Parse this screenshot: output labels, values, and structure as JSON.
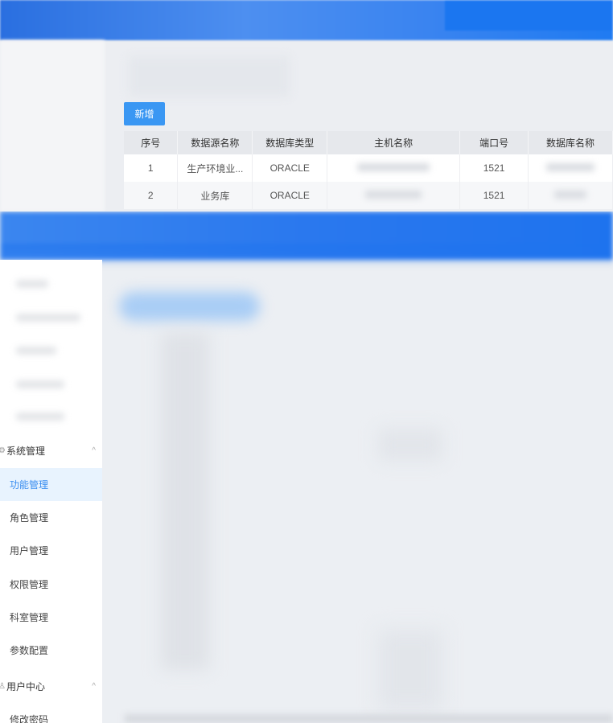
{
  "toolbar": {
    "add_label": "新增"
  },
  "table": {
    "headers": [
      "序号",
      "数据源名称",
      "数据库类型",
      "主机名称",
      "端口号",
      "数据库名称"
    ],
    "rows": [
      {
        "index": "1",
        "name": "生产环境业...",
        "type": "ORACLE",
        "host": "",
        "port": "1521",
        "db": ""
      },
      {
        "index": "2",
        "name": "业务库",
        "type": "ORACLE",
        "host": "",
        "port": "1521",
        "db": ""
      }
    ]
  },
  "sidebar": {
    "system_group": {
      "label": "系统管理",
      "icon": "gear-icon",
      "chevron": "^"
    },
    "items": [
      {
        "label": "功能管理",
        "active": true
      },
      {
        "label": "角色管理"
      },
      {
        "label": "用户管理"
      },
      {
        "label": "权限管理"
      },
      {
        "label": "科室管理"
      },
      {
        "label": "参数配置"
      }
    ],
    "user_group": {
      "label": "用户中心",
      "icon": "user-icon",
      "chevron": "^"
    },
    "user_items": [
      {
        "label": "修改密码"
      }
    ]
  },
  "colors": {
    "accent": "#3a97f3",
    "active_bg": "#e8f3fe",
    "active_text": "#3a8ef0",
    "header_blue": "#1b76f0"
  }
}
